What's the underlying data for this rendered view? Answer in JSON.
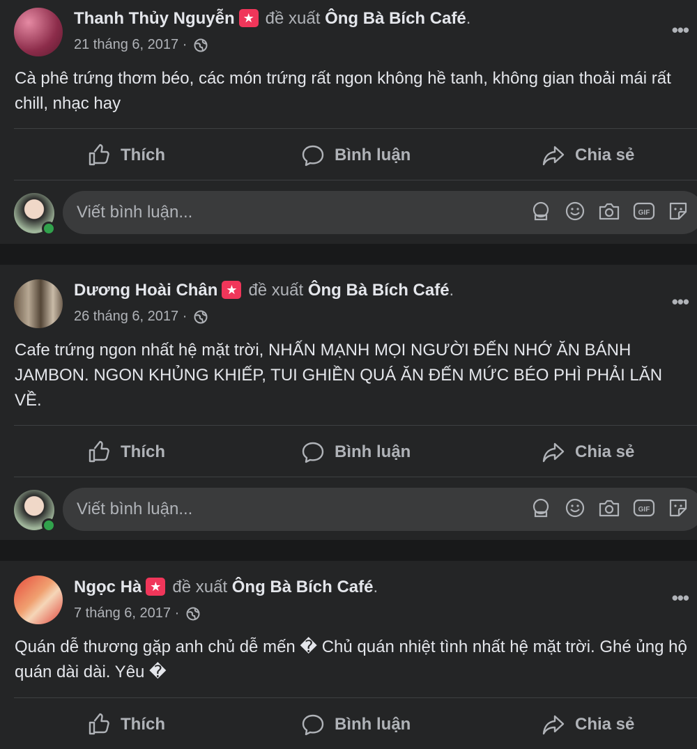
{
  "posts": [
    {
      "author": "Thanh Thủy Nguyễn",
      "verb": "đề xuất",
      "page": "Ông Bà Bích Café",
      "date": "21 tháng 6, 2017 ·",
      "text": "Cà phê trứng thơm béo, các món trứng rất ngon không hề tanh,  không gian thoải mái rất chill,  nhạc hay",
      "avatar_color": "#b64a66"
    },
    {
      "author": "Dương Hoài Chân",
      "verb": "đề xuất",
      "page": "Ông Bà Bích Café",
      "date": "26 tháng 6, 2017 ·",
      "text": "Cafe trứng ngon nhất hệ mặt trời, NHẤN MẠNH MỌI NGƯỜI ĐẾN NHỚ ĂN BÁNH JAMBON. NGON KHỦNG KHIẾP, TUI GHIỀN QUÁ ĂN ĐẾN MỨC BÉO PHÌ PHẢI LĂN VỀ.",
      "avatar_color": "#8a7c6a"
    },
    {
      "author": "Ngọc Hà",
      "verb": "đề xuất",
      "page": "Ông Bà Bích Café",
      "date": "7 tháng 6, 2017 ·",
      "text": "Quán dễ thương gặp anh chủ dễ mến � Chủ quán nhiệt tình nhất hệ mặt trời. Ghé ủng hộ quán dài dài. Yêu �",
      "avatar_color": "#d9534f"
    }
  ],
  "actions": {
    "like": "Thích",
    "comment": "Bình luận",
    "share": "Chia sẻ"
  },
  "comment_placeholder": "Viết bình luận...",
  "more_label": "•••",
  "colors": {
    "background": "#18191a",
    "card": "#242526",
    "secondary_text": "#b0b3b8",
    "badge": "#f0365a",
    "online": "#31a24c"
  },
  "icons": [
    "recommend-badge-icon",
    "globe-icon",
    "more-icon",
    "like-icon",
    "comment-icon",
    "share-icon",
    "avatar-frame-icon",
    "emoji-icon",
    "camera-icon",
    "gif-icon",
    "sticker-icon"
  ]
}
